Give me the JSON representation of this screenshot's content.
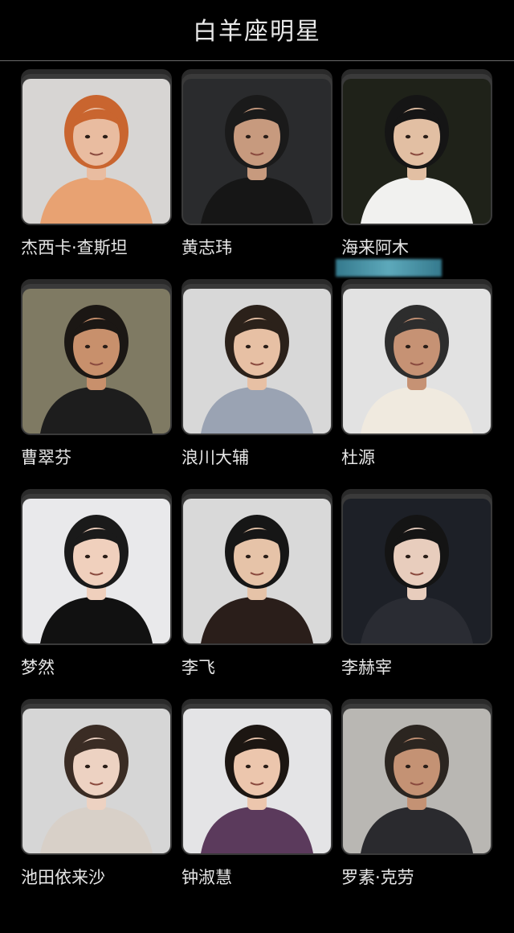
{
  "header": {
    "title": "白羊座明星"
  },
  "cards": [
    {
      "name": "杰西卡·查斯坦",
      "icon": "person-photo",
      "bg": "#d7d5d3",
      "skin": "#e9bca0",
      "hair": "#c9652f",
      "cloth": "#e8a272"
    },
    {
      "name": "黄志玮",
      "icon": "person-photo",
      "bg": "#2a2b2d",
      "skin": "#c79a7e",
      "hair": "#1a1a1a",
      "cloth": "#161616"
    },
    {
      "name": "海来阿木",
      "icon": "person-photo",
      "bg": "#1f2219",
      "skin": "#e2bfa3",
      "hair": "#151515",
      "cloth": "#f1f1ef"
    },
    {
      "name": "曹翠芬",
      "icon": "person-photo",
      "bg": "#7f7a63",
      "skin": "#c8906c",
      "hair": "#1b1714",
      "cloth": "#1d1d1d"
    },
    {
      "name": "浪川大辅",
      "icon": "person-photo",
      "bg": "#d8d8d8",
      "skin": "#e7c0a4",
      "hair": "#2b211a",
      "cloth": "#9aa3b3"
    },
    {
      "name": "杜源",
      "icon": "person-photo",
      "bg": "#e2e2e2",
      "skin": "#c69274",
      "hair": "#2d2d2d",
      "cloth": "#f0eadf"
    },
    {
      "name": "梦然",
      "icon": "person-photo",
      "bg": "#e9e9eb",
      "skin": "#f0d0bd",
      "hair": "#1a1a1a",
      "cloth": "#111111"
    },
    {
      "name": "李飞",
      "icon": "person-photo",
      "bg": "#d9d9d9",
      "skin": "#e6c3a8",
      "hair": "#161616",
      "cloth": "#2a1e1a"
    },
    {
      "name": "李赫宰",
      "icon": "person-photo",
      "bg": "#1d2027",
      "skin": "#e8cdbd",
      "hair": "#141414",
      "cloth": "#2a2c33"
    },
    {
      "name": "池田依来沙",
      "icon": "person-photo",
      "bg": "#d6d6d6",
      "skin": "#edd2c2",
      "hair": "#3a2c24",
      "cloth": "#d8d0c8"
    },
    {
      "name": "钟淑慧",
      "icon": "person-photo",
      "bg": "#e4e4e6",
      "skin": "#ecc6ad",
      "hair": "#1c1612",
      "cloth": "#5b3a5c"
    },
    {
      "name": "罗素·克劳",
      "icon": "person-photo",
      "bg": "#b9b7b3",
      "skin": "#c49274",
      "hair": "#2b2520",
      "cloth": "#2a2a2e"
    }
  ]
}
